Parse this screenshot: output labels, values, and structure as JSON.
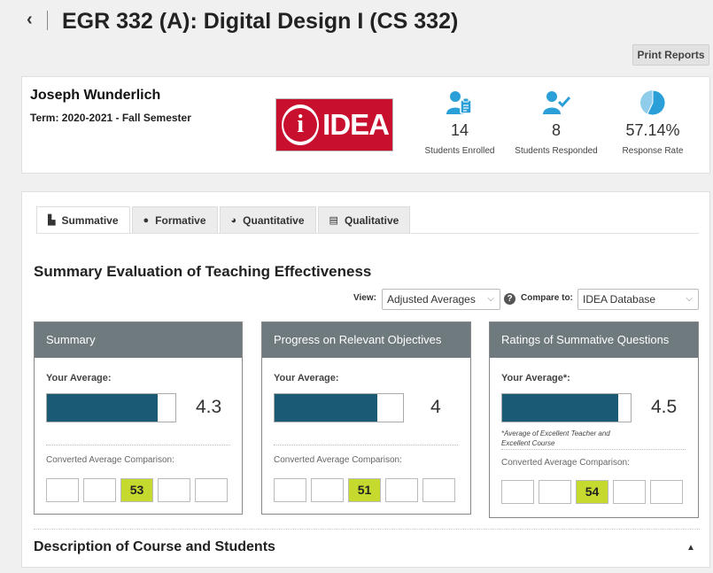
{
  "header": {
    "back_glyph": "‹",
    "title": "EGR 332 (A): Digital Design I (CS 332)"
  },
  "toolbar": {
    "print_label": "Print Reports"
  },
  "instructor": {
    "name": "Joseph Wunderlich",
    "term": "Term: 2020-2021 - Fall Semester"
  },
  "logo": {
    "glyph": "i",
    "text": "IDEA"
  },
  "stats": [
    {
      "value": "14",
      "label": "Students Enrolled",
      "icon": "user-clipboard-icon"
    },
    {
      "value": "8",
      "label": "Students Responded",
      "icon": "user-check-icon"
    },
    {
      "value": "57.14%",
      "label": "Response Rate",
      "icon": "pie-chart-icon",
      "fraction": 0.5714
    }
  ],
  "tabs": [
    {
      "label": "Summative",
      "icon": "bar-chart-icon",
      "glyph": "▙",
      "active": true
    },
    {
      "label": "Formative",
      "icon": "info-icon",
      "glyph": "●",
      "active": false
    },
    {
      "label": "Quantitative",
      "icon": "pie-icon",
      "glyph": "◕",
      "active": false
    },
    {
      "label": "Qualitative",
      "icon": "list-icon",
      "glyph": "▤",
      "active": false
    }
  ],
  "section": {
    "title": "Summary Evaluation of Teaching Effectiveness"
  },
  "filters": {
    "view_label": "View:",
    "view_value": "Adjusted Averages",
    "help_glyph": "?",
    "compare_label": "Compare to:",
    "compare_value": "IDEA Database"
  },
  "cards": [
    {
      "title": "Summary",
      "avg_label": "Your Average:",
      "avg": "4.3",
      "fill": 0.86,
      "note": "",
      "conv_label": "Converted Average Comparison:",
      "boxes": [
        "",
        "",
        "53",
        "",
        ""
      ],
      "highlight": 2
    },
    {
      "title": "Progress on Relevant Objectives",
      "avg_label": "Your Average:",
      "avg": "4",
      "fill": 0.8,
      "note": "",
      "conv_label": "Converted Average Comparison:",
      "boxes": [
        "",
        "",
        "51",
        "",
        ""
      ],
      "highlight": 2
    },
    {
      "title": "Ratings of Summative Questions",
      "avg_label": "Your Average*:",
      "avg": "4.5",
      "fill": 0.9,
      "note": "*Average of Excellent Teacher and Excellent Course",
      "conv_label": "Converted Average Comparison:",
      "boxes": [
        "",
        "",
        "54",
        "",
        ""
      ],
      "highlight": 2
    }
  ],
  "description": {
    "title": "Description of Course and Students",
    "caret": "▲"
  },
  "colors": {
    "bar": "#1a5a75",
    "highlight": "#c6d92e",
    "card_header": "#6f7a7f",
    "icon_blue": "#2a9fd8",
    "logo_red": "#c8102e"
  }
}
